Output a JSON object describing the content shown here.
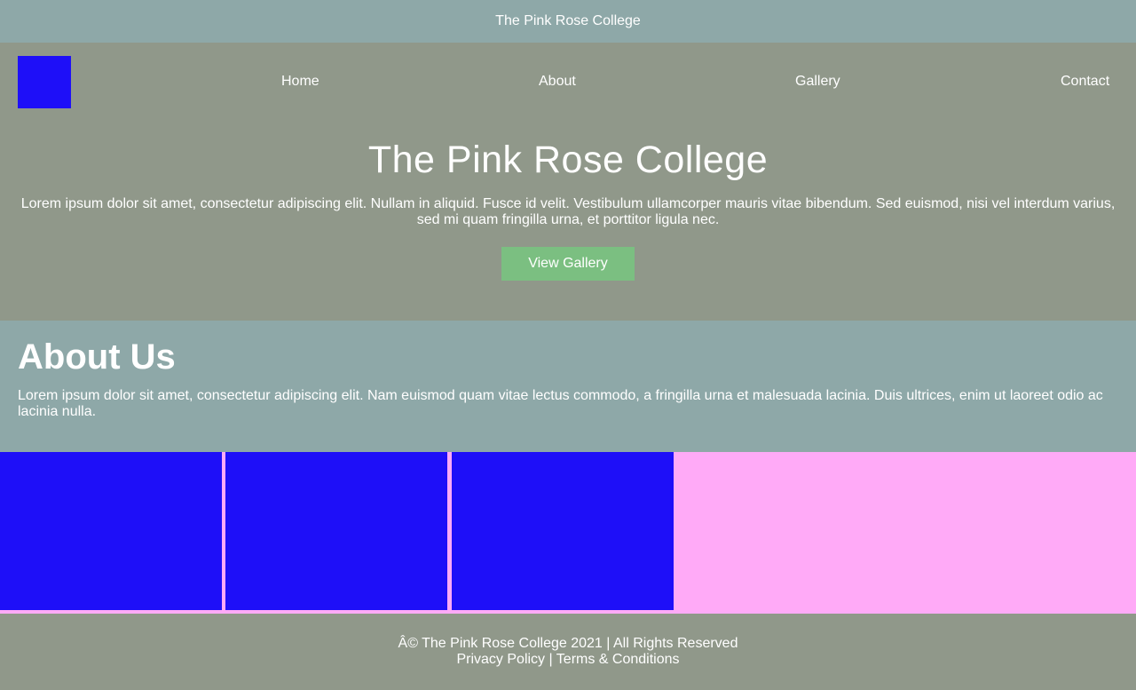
{
  "topbar": {
    "title": "The Pink Rose College"
  },
  "nav": {
    "items": [
      {
        "label": "Home"
      },
      {
        "label": "About"
      },
      {
        "label": "Gallery"
      },
      {
        "label": "Contact"
      }
    ]
  },
  "hero": {
    "title": "The Pink Rose College",
    "text": "Lorem ipsum dolor sit amet, consectetur adipiscing elit. Nullam in aliquid. Fusce id velit. Vestibulum ullamcorper mauris vitae bibendum. Sed euismod, nisi vel interdum varius, sed mi quam fringilla urna, et porttitor ligula nec.",
    "button_label": "View Gallery"
  },
  "about": {
    "title": "About Us",
    "text": "Lorem ipsum dolor sit amet, consectetur adipiscing elit. Nam euismod quam vitae lectus commodo, a fringilla urna et malesuada lacinia. Duis ultrices, enim ut laoreet odio ac lacinia nulla."
  },
  "footer": {
    "copyright": "Â© The Pink Rose College 2021 | All Rights Reserved",
    "links": "Privacy Policy | Terms & Conditions"
  },
  "colors": {
    "teal_bar": "#8ea8a8",
    "olive_section": "#90988a",
    "accent_blue": "#1e0ff8",
    "button_green": "#7bbf81",
    "pink_bg": "#ffaaf7"
  }
}
